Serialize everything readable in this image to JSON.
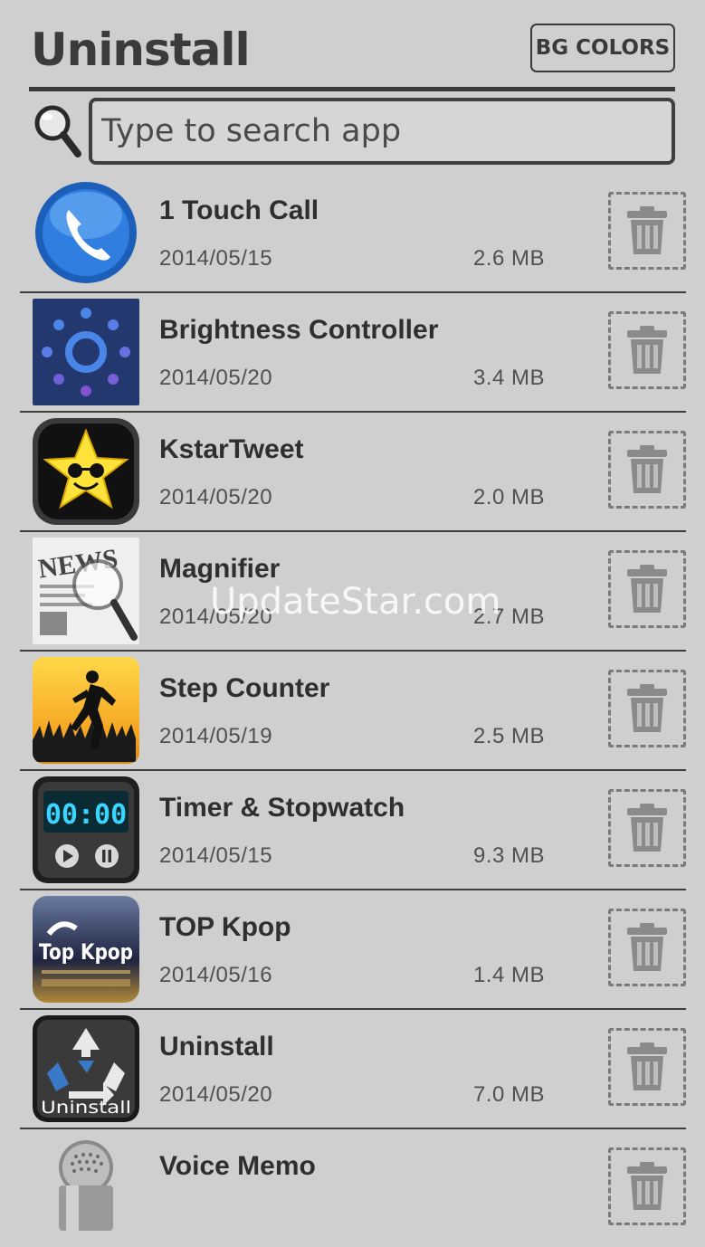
{
  "header": {
    "title": "Uninstall",
    "bg_colors_label": "BG COLORS"
  },
  "search": {
    "placeholder": "Type to search app"
  },
  "apps": [
    {
      "name": "1 Touch Call",
      "date": "2014/05/15",
      "size": "2.6 MB",
      "icon": "phone-icon"
    },
    {
      "name": "Brightness Controller",
      "date": "2014/05/20",
      "size": "3.4 MB",
      "icon": "brightness-icon"
    },
    {
      "name": "KstarTweet",
      "date": "2014/05/20",
      "size": "2.0 MB",
      "icon": "star-sunglasses-icon"
    },
    {
      "name": "Magnifier",
      "date": "2014/05/20",
      "size": "2.7 MB",
      "icon": "news-magnifier-icon"
    },
    {
      "name": "Step Counter",
      "date": "2014/05/19",
      "size": "2.5 MB",
      "icon": "runner-icon"
    },
    {
      "name": "Timer & Stopwatch",
      "date": "2014/05/15",
      "size": "9.3 MB",
      "icon": "stopwatch-icon"
    },
    {
      "name": "TOP Kpop",
      "date": "2014/05/16",
      "size": "1.4 MB",
      "icon": "top-kpop-icon",
      "icon_text": "Top Kpop"
    },
    {
      "name": "Uninstall",
      "date": "2014/05/20",
      "size": "7.0 MB",
      "icon": "recycle-icon",
      "icon_text": "Uninstall"
    },
    {
      "name": "Voice Memo",
      "date": "",
      "size": "",
      "icon": "microphone-icon"
    }
  ],
  "timer_icon_text": "00:00",
  "magnifier_icon_text": "NEWS",
  "watermark": "UpdateStar.com",
  "colors": {
    "background": "#cfcfcf",
    "text": "#2f2f2f",
    "border": "#3a3a3a"
  }
}
